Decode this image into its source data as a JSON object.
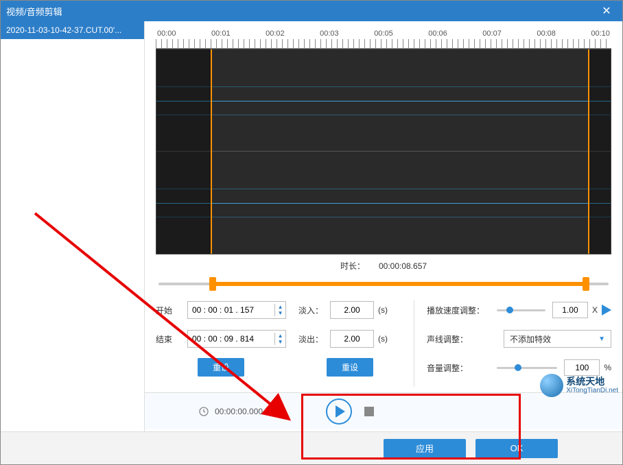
{
  "window": {
    "title": "视频/音频剪辑",
    "close_glyph": "✕"
  },
  "sidebar": {
    "items": [
      "2020-11-03-10-42-37.CUT.00'..."
    ]
  },
  "timeline": {
    "ticks": [
      "00:00",
      "00:01",
      "00:02",
      "00:03",
      "00:05",
      "00:06",
      "00:07",
      "00:08",
      "00:10"
    ],
    "duration_label": "时长：",
    "duration_value": "00:00:08.657",
    "sel_start_pct": 12,
    "sel_end_pct": 95
  },
  "trim": {
    "start_label": "开始",
    "start_value": "00 : 00 : 01 . 157",
    "end_label": "结束",
    "end_value": "00 : 00 : 09 . 814",
    "reset_label": "重设"
  },
  "fade": {
    "in_label": "淡入：",
    "in_value": "2.00",
    "out_label": "淡出：",
    "out_value": "2.00",
    "unit": "(s)",
    "reset_label": "重设"
  },
  "speed": {
    "label": "播放速度调整：",
    "value": "1.00",
    "unit": "X",
    "slider_pct": 20
  },
  "voice": {
    "label": "声线调整：",
    "selected": "不添加特效"
  },
  "volume": {
    "label": "音量调整：",
    "value": "100",
    "unit": "%",
    "slider_pct": 30
  },
  "player": {
    "time": "00:00:00.000"
  },
  "bottom": {
    "apply": "应用",
    "ok": "OK"
  },
  "watermark": {
    "zh": "系统天地",
    "en": "XiTongTianDi.net"
  }
}
